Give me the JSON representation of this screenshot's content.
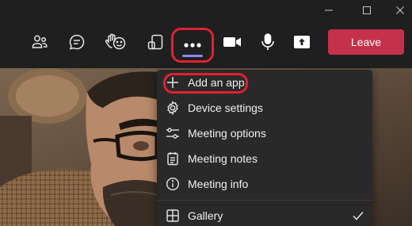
{
  "window": {
    "minimize_icon": "minimize-icon",
    "maximize_icon": "maximize-icon",
    "close_icon": "close-icon"
  },
  "toolbar": {
    "people_icon": "people-icon",
    "chat_icon": "chat-icon",
    "react_icon": "raise-hand-react-icon",
    "rooms_icon": "breakout-rooms-icon",
    "more_icon": "more-options-icon",
    "camera_icon": "camera-icon",
    "mic_icon": "microphone-icon",
    "share_icon": "share-icon",
    "leave_label": "Leave",
    "leave_color": "#c4314b",
    "accent": "#8b8cf0"
  },
  "menu": {
    "items": [
      {
        "label": "Add an app",
        "icon": "plus-icon"
      },
      {
        "label": "Device settings",
        "icon": "gear-icon"
      },
      {
        "label": "Meeting options",
        "icon": "sliders-icon"
      },
      {
        "label": "Meeting notes",
        "icon": "notes-icon"
      },
      {
        "label": "Meeting info",
        "icon": "info-icon"
      },
      {
        "label": "Gallery",
        "icon": "gallery-grid-icon",
        "checked": true
      }
    ]
  },
  "highlight_color": "#e0222e"
}
